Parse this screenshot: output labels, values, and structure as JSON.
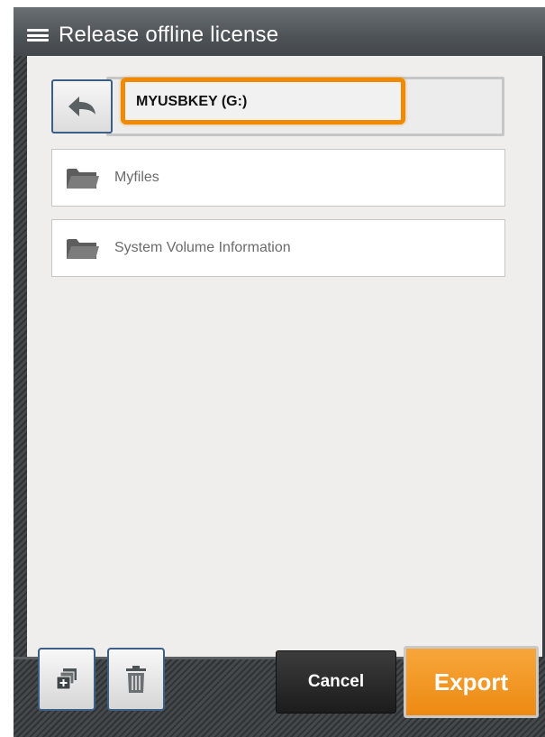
{
  "window": {
    "title": "Release offline license"
  },
  "path": {
    "current": "MYUSBKEY (G:)"
  },
  "folders": [
    {
      "name": "Myfiles"
    },
    {
      "name": "System Volume Information"
    }
  ],
  "toolbar": {
    "cancel_label": "Cancel",
    "export_label": "Export"
  },
  "icons": {
    "menu": "hamburger-icon",
    "back": "back-arrow-icon",
    "folder": "folder-icon",
    "new_folder": "new-folder-icon",
    "delete": "trash-icon"
  },
  "colors": {
    "accent": "#f08a00",
    "export": "#ed8a13",
    "titlebar": "#4d5256",
    "button_border": "#3b5f86"
  }
}
